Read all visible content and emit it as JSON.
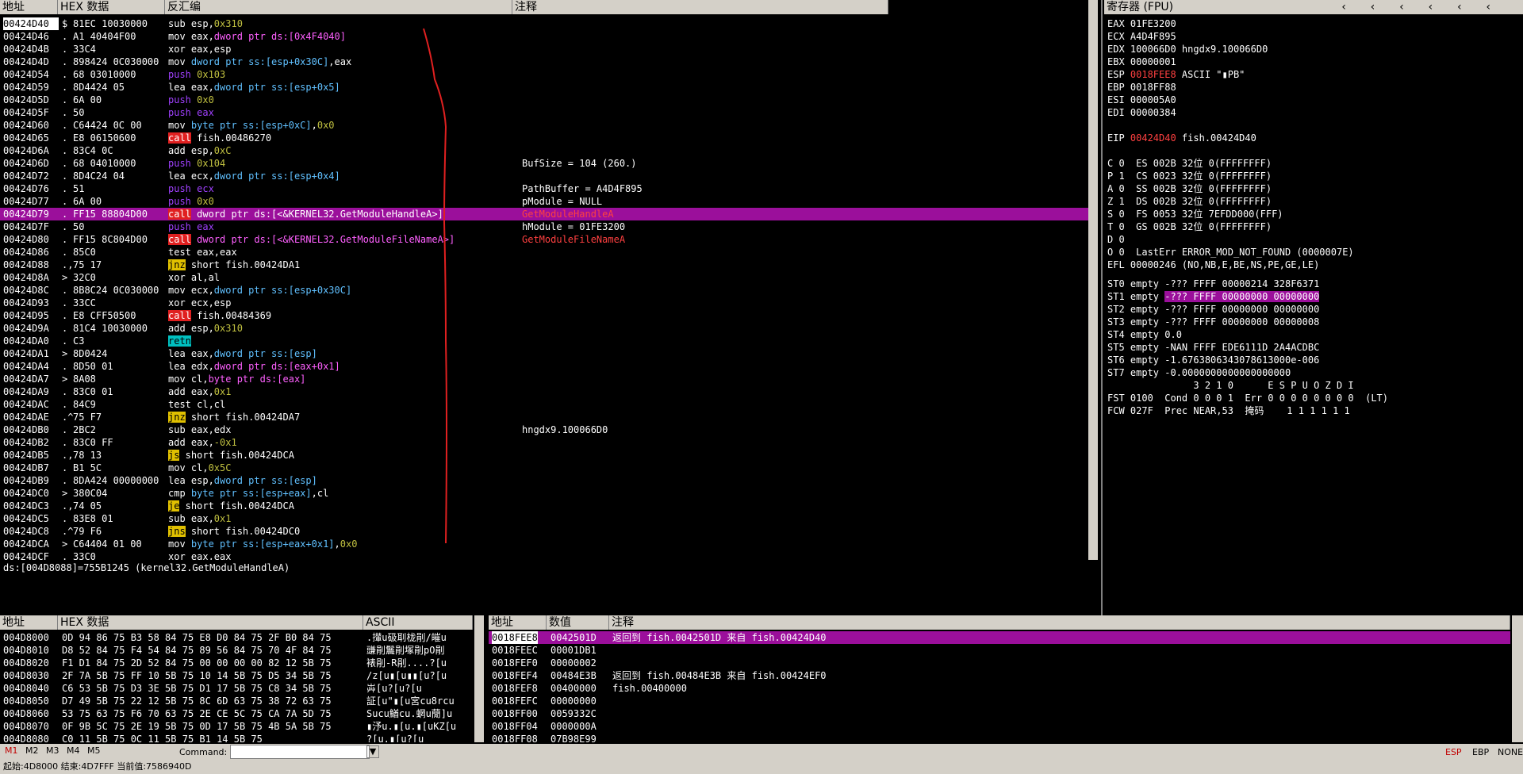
{
  "cpu": {
    "headers": {
      "addr": "地址",
      "hex": "HEX 数据",
      "disasm": "反汇编",
      "comment": "注释"
    },
    "rows": [
      {
        "addr": "00424D40",
        "m": "$",
        "hex": "81EC 10030000",
        "asm": [
          [
            "sub esp,",
            ""
          ],
          [
            "0x310",
            "imm"
          ]
        ],
        "cmt": ""
      },
      {
        "addr": "00424D46",
        "m": ".",
        "hex": "A1 40404F00",
        "asm": [
          [
            "mov eax,",
            ""
          ],
          [
            "dword ptr ds:[0x4F4040]",
            "mem"
          ]
        ],
        "cmt": ""
      },
      {
        "addr": "00424D4B",
        "m": ".",
        "hex": "33C4",
        "asm": [
          [
            "xor eax,esp",
            ""
          ]
        ],
        "cmt": ""
      },
      {
        "addr": "00424D4D",
        "m": ".",
        "hex": "898424 0C030000",
        "asm": [
          [
            "mov ",
            ""
          ],
          [
            "dword ptr ss:[esp+0x30C]",
            "blue"
          ],
          [
            ",eax",
            ""
          ]
        ],
        "cmt": ""
      },
      {
        "addr": "00424D54",
        "m": ".",
        "hex": "68 03010000",
        "asm": [
          [
            "push ",
            "push"
          ],
          [
            "0x103",
            "imm"
          ]
        ],
        "cmt": ""
      },
      {
        "addr": "00424D59",
        "m": ".",
        "hex": "8D4424 05",
        "asm": [
          [
            "lea eax,",
            ""
          ],
          [
            "dword ptr ss:[esp+0x5]",
            "blue"
          ]
        ],
        "cmt": ""
      },
      {
        "addr": "00424D5D",
        "m": ".",
        "hex": "6A 00",
        "asm": [
          [
            "push ",
            "push"
          ],
          [
            "0x0",
            "imm"
          ]
        ],
        "cmt": ""
      },
      {
        "addr": "00424D5F",
        "m": ".",
        "hex": "50",
        "asm": [
          [
            "push eax",
            "push"
          ]
        ],
        "cmt": ""
      },
      {
        "addr": "00424D60",
        "m": ".",
        "hex": "C64424 0C 00",
        "asm": [
          [
            "mov ",
            ""
          ],
          [
            "byte ptr ss:[esp+0xC]",
            "blue"
          ],
          [
            ",",
            ""
          ],
          [
            "0x0",
            "imm"
          ]
        ],
        "cmt": ""
      },
      {
        "addr": "00424D65",
        "m": ".",
        "hex": "E8 06150600",
        "asm": [
          [
            "call",
            "call"
          ],
          [
            " fish.00486270",
            ""
          ]
        ],
        "cmt": ""
      },
      {
        "addr": "00424D6A",
        "m": ".",
        "hex": "83C4 0C",
        "asm": [
          [
            "add esp,",
            ""
          ],
          [
            "0xC",
            "imm"
          ]
        ],
        "cmt": ""
      },
      {
        "addr": "00424D6D",
        "m": ".",
        "hex": "68 04010000",
        "asm": [
          [
            "push ",
            "push"
          ],
          [
            "0x104",
            "imm"
          ]
        ],
        "cmt": "BufSize = 104 (260.)"
      },
      {
        "addr": "00424D72",
        "m": ".",
        "hex": "8D4C24 04",
        "asm": [
          [
            "lea ecx,",
            ""
          ],
          [
            "dword ptr ss:[esp+0x4]",
            "blue"
          ]
        ],
        "cmt": ""
      },
      {
        "addr": "00424D76",
        "m": ".",
        "hex": "51",
        "asm": [
          [
            "push ecx",
            "push"
          ]
        ],
        "cmt": "PathBuffer = A4D4F895"
      },
      {
        "addr": "00424D77",
        "m": ".",
        "hex": "6A 00",
        "asm": [
          [
            "push ",
            "push"
          ],
          [
            "0x0",
            "imm"
          ]
        ],
        "cmt": "pModule = NULL"
      },
      {
        "addr": "00424D79",
        "m": ".",
        "hex": "FF15 88804D00",
        "asm": [
          [
            "call",
            "call"
          ],
          [
            " dword ptr ds:[<&KERNEL32.GetModuleHandleA>]",
            ""
          ]
        ],
        "cmt": "GetModuleHandleA",
        "sel": true
      },
      {
        "addr": "00424D7F",
        "m": ".",
        "hex": "50",
        "asm": [
          [
            "push eax",
            "push"
          ]
        ],
        "cmt": "hModule = 01FE3200"
      },
      {
        "addr": "00424D80",
        "m": ".",
        "hex": "FF15 8C804D00",
        "asm": [
          [
            "call",
            "call"
          ],
          [
            " dword ptr ds:[<&KERNEL32.GetModuleFileNameA>]",
            "mem"
          ]
        ],
        "cmt": "GetModuleFileNameA"
      },
      {
        "addr": "00424D86",
        "m": ".",
        "hex": "85C0",
        "asm": [
          [
            "test eax,eax",
            ""
          ]
        ],
        "cmt": ""
      },
      {
        "addr": "00424D88",
        "m": ".,",
        "hex": "75 17",
        "asm": [
          [
            "jnz",
            "jcc"
          ],
          [
            " short fish.00424DA1",
            ""
          ]
        ],
        "cmt": ""
      },
      {
        "addr": "00424D8A",
        "m": ">",
        "hex": "32C0",
        "asm": [
          [
            "xor al,al",
            ""
          ]
        ],
        "cmt": ""
      },
      {
        "addr": "00424D8C",
        "m": ".",
        "hex": "8B8C24 0C030000",
        "asm": [
          [
            "mov ecx,",
            ""
          ],
          [
            "dword ptr ss:[esp+0x30C]",
            "blue"
          ]
        ],
        "cmt": ""
      },
      {
        "addr": "00424D93",
        "m": ".",
        "hex": "33CC",
        "asm": [
          [
            "xor ecx,esp",
            ""
          ]
        ],
        "cmt": ""
      },
      {
        "addr": "00424D95",
        "m": ".",
        "hex": "E8 CFF50500",
        "asm": [
          [
            "call",
            "call"
          ],
          [
            " fish.00484369",
            ""
          ]
        ],
        "cmt": ""
      },
      {
        "addr": "00424D9A",
        "m": ".",
        "hex": "81C4 10030000",
        "asm": [
          [
            "add esp,",
            ""
          ],
          [
            "0x310",
            "imm"
          ]
        ],
        "cmt": ""
      },
      {
        "addr": "00424DA0",
        "m": ".",
        "hex": "C3",
        "asm": [
          [
            "retn",
            "retn"
          ]
        ],
        "cmt": ""
      },
      {
        "addr": "00424DA1",
        "m": ">",
        "hex": "8D0424",
        "asm": [
          [
            "lea eax,",
            ""
          ],
          [
            "dword ptr ss:[esp]",
            "blue"
          ]
        ],
        "cmt": ""
      },
      {
        "addr": "00424DA4",
        "m": ".",
        "hex": "8D50 01",
        "asm": [
          [
            "lea edx,",
            ""
          ],
          [
            "dword ptr ds:[eax+0x1]",
            "mem"
          ]
        ],
        "cmt": ""
      },
      {
        "addr": "00424DA7",
        "m": ">",
        "hex": "8A08",
        "asm": [
          [
            "mov cl,",
            ""
          ],
          [
            "byte ptr ds:[eax]",
            "mem"
          ]
        ],
        "cmt": ""
      },
      {
        "addr": "00424DA9",
        "m": ".",
        "hex": "83C0 01",
        "asm": [
          [
            "add eax,",
            ""
          ],
          [
            "0x1",
            "imm"
          ]
        ],
        "cmt": ""
      },
      {
        "addr": "00424DAC",
        "m": ".",
        "hex": "84C9",
        "asm": [
          [
            "test cl,cl",
            ""
          ]
        ],
        "cmt": ""
      },
      {
        "addr": "00424DAE",
        "m": ".^",
        "hex": "75 F7",
        "asm": [
          [
            "jnz",
            "jcc"
          ],
          [
            " short fish.00424DA7",
            ""
          ]
        ],
        "cmt": ""
      },
      {
        "addr": "00424DB0",
        "m": ".",
        "hex": "2BC2",
        "asm": [
          [
            "sub eax,edx",
            ""
          ]
        ],
        "cmt": "hngdx9.100066D0"
      },
      {
        "addr": "00424DB2",
        "m": ".",
        "hex": "83C0 FF",
        "asm": [
          [
            "add eax,",
            ""
          ],
          [
            "-0x1",
            "imm"
          ]
        ],
        "cmt": ""
      },
      {
        "addr": "00424DB5",
        "m": ".,",
        "hex": "78 13",
        "asm": [
          [
            "js",
            "jcc"
          ],
          [
            " short fish.00424DCA",
            ""
          ]
        ],
        "cmt": ""
      },
      {
        "addr": "00424DB7",
        "m": ".",
        "hex": "B1 5C",
        "asm": [
          [
            "mov cl,",
            ""
          ],
          [
            "0x5C",
            "imm"
          ]
        ],
        "cmt": ""
      },
      {
        "addr": "00424DB9",
        "m": ".",
        "hex": "8DA424 00000000",
        "asm": [
          [
            "lea esp,",
            ""
          ],
          [
            "dword ptr ss:[esp]",
            "blue"
          ]
        ],
        "cmt": ""
      },
      {
        "addr": "00424DC0",
        "m": ">",
        "hex": "380C04",
        "asm": [
          [
            "cmp ",
            ""
          ],
          [
            "byte ptr ss:[esp+eax]",
            "blue"
          ],
          [
            ",cl",
            ""
          ]
        ],
        "cmt": ""
      },
      {
        "addr": "00424DC3",
        "m": ".,",
        "hex": "74 05",
        "asm": [
          [
            "je",
            "jcc"
          ],
          [
            " short fish.00424DCA",
            ""
          ]
        ],
        "cmt": ""
      },
      {
        "addr": "00424DC5",
        "m": ".",
        "hex": "83E8 01",
        "asm": [
          [
            "sub eax,",
            ""
          ],
          [
            "0x1",
            "imm"
          ]
        ],
        "cmt": ""
      },
      {
        "addr": "00424DC8",
        "m": ".^",
        "hex": "79 F6",
        "asm": [
          [
            "jns",
            "jcc"
          ],
          [
            " short fish.00424DC0",
            ""
          ]
        ],
        "cmt": ""
      },
      {
        "addr": "00424DCA",
        "m": ">",
        "hex": "C64404 01 00",
        "asm": [
          [
            "mov ",
            ""
          ],
          [
            "byte ptr ss:[esp+eax+0x1]",
            "blue"
          ],
          [
            ",",
            ""
          ],
          [
            "0x0",
            "imm"
          ]
        ],
        "cmt": ""
      },
      {
        "addr": "00424DCF",
        "m": ".",
        "hex": "33C0",
        "asm": [
          [
            "xor eax,eax",
            ""
          ]
        ],
        "cmt": ""
      }
    ],
    "info_line": "ds:[004D8088]=755B1245 (kernel32.GetModuleHandleA)"
  },
  "registers": {
    "title": "寄存器 (FPU)",
    "general": [
      {
        "name": "EAX",
        "value": "01FE3200",
        "desc": ""
      },
      {
        "name": "ECX",
        "value": "A4D4F895",
        "desc": ""
      },
      {
        "name": "EDX",
        "value": "100066D0",
        "desc": "hngdx9.100066D0"
      },
      {
        "name": "EBX",
        "value": "00000001",
        "desc": ""
      },
      {
        "name": "ESP",
        "value": "0018FEE8",
        "desc": "ASCII \"▮PB\"",
        "red": true
      },
      {
        "name": "EBP",
        "value": "0018FF88",
        "desc": ""
      },
      {
        "name": "ESI",
        "value": "000005A0",
        "desc": ""
      },
      {
        "name": "EDI",
        "value": "00000384",
        "desc": ""
      }
    ],
    "eip": {
      "name": "EIP",
      "value": "00424D40",
      "desc": "fish.00424D40"
    },
    "flags": [
      "C 0  ES 002B 32位 0(FFFFFFFF)",
      "P 1  CS 0023 32位 0(FFFFFFFF)",
      "A 0  SS 002B 32位 0(FFFFFFFF)",
      "Z 1  DS 002B 32位 0(FFFFFFFF)",
      "S 0  FS 0053 32位 7EFDD000(FFF)",
      "T 0  GS 002B 32位 0(FFFFFFFF)",
      "D 0",
      "O 0  LastErr ERROR_MOD_NOT_FOUND (0000007E)"
    ],
    "efl": "EFL 00000246 (NO,NB,E,BE,NS,PE,GE,LE)",
    "fpu": [
      {
        "text": "ST0 empty -??? FFFF 00000214 328F6371",
        "hl": ""
      },
      {
        "text": "ST1 empty ",
        "hl": "-??? FFFF 00000000 00000000"
      },
      {
        "text": "ST2 empty -??? FFFF 00000000 00000000",
        "hl": ""
      },
      {
        "text": "ST3 empty -??? FFFF 00000000 00000008",
        "hl": ""
      },
      {
        "text": "ST4 empty 0.0",
        "hl": ""
      },
      {
        "text": "ST5 empty -NAN FFFF EDE6111D 2A4ACDBC",
        "hl": ""
      },
      {
        "text": "ST6 empty -1.6763806343078613000e-006",
        "hl": ""
      },
      {
        "text": "ST7 empty -0.0000000000000000000",
        "hl": ""
      }
    ],
    "fpu_tail": [
      "               3 2 1 0      E S P U O Z D I",
      "FST 0100  Cond 0 0 0 1  Err 0 0 0 0 0 0 0 0  (LT)",
      "FCW 027F  Prec NEAR,53  掩码    1 1 1 1 1 1"
    ]
  },
  "dump": {
    "headers": {
      "addr": "地址",
      "hex": "HEX 数据",
      "ascii": "ASCII"
    },
    "rows": [
      {
        "addr": "004D8000",
        "hex": "0D 94 86 75 B3 58 84 75 E8 D0 84 75 2F B0 84 75",
        "ascii": ".攆u砐刵栊剈/皠u"
      },
      {
        "addr": "004D8010",
        "hex": "D8 52 84 75 F4 54 84 75 89 56 84 75 70 4F 84 75",
        "ascii": "豏剈鬞剈塚剈pO剈"
      },
      {
        "addr": "004D8020",
        "hex": "F1 D1 84 75 2D 52 84 75 00 00 00 00 82 12 5B 75",
        "ascii": "裱剈-R剈....?[u"
      },
      {
        "addr": "004D8030",
        "hex": "2F 7A 5B 75 FF 10 5B 75 10 14 5B 75 D5 34 5B 75",
        "ascii": "/z[u▮[u▮▮[u?[u"
      },
      {
        "addr": "004D8040",
        "hex": "C6 53 5B 75 D3 3E 5B 75 D1 17 5B 75 C8 34 5B 75",
        "ascii": "芔[u?[u?[u"
      },
      {
        "addr": "004D8050",
        "hex": "D7 49 5B 75 22 12 5B 75 8C 6D 63 75 38 72 63 75",
        "ascii": "証[u\"▮[u宮cu8rcu"
      },
      {
        "addr": "004D8060",
        "hex": "53 75 63 75 F6 70 63 75 2E CE 5C 75 CA 7A 5D 75",
        "ascii": "Sucu鰌cu.蝄u蕑]u"
      },
      {
        "addr": "004D8070",
        "hex": "0F 9B 5C 75 2E 19 5B 75 0D 17 5B 75 4B 5A 5B 75",
        "ascii": "▮汿u.▮[u.▮[uKZ[u"
      },
      {
        "addr": "004D8080",
        "hex": "C0 11 5B 75 0C 11 5B 75 B1 14 5B 75",
        "ascii": "?[u.▮[u?[u"
      }
    ]
  },
  "stack": {
    "headers": {
      "addr": "地址",
      "val": "数值",
      "cmt": "注释"
    },
    "rows": [
      {
        "addr": "0018FEE8",
        "val": "0042501D",
        "cmt": "返回到 fish.0042501D 来自 fish.00424D40",
        "sel": true
      },
      {
        "addr": "0018FEEC",
        "val": "00001DB1",
        "cmt": ""
      },
      {
        "addr": "0018FEF0",
        "val": "00000002",
        "cmt": ""
      },
      {
        "addr": "0018FEF4",
        "val": "00484E3B",
        "cmt": "返回到 fish.00484E3B 来自 fish.00424EF0"
      },
      {
        "addr": "0018FEF8",
        "val": "00400000",
        "cmt": "fish.00400000"
      },
      {
        "addr": "0018FEFC",
        "val": "00000000",
        "cmt": ""
      },
      {
        "addr": "0018FF00",
        "val": "0059332C",
        "cmt": ""
      },
      {
        "addr": "0018FF04",
        "val": "0000000A",
        "cmt": ""
      },
      {
        "addr": "0018FF08",
        "val": "07B98E99",
        "cmt": ""
      }
    ]
  },
  "cmdbar": {
    "tabs": [
      "M1",
      "M2",
      "M3",
      "M4",
      "M5"
    ],
    "command_label": "Command:",
    "command_value": "",
    "right": [
      "ESP",
      "EBP",
      "NONE"
    ]
  },
  "status": "起始:4D8000 结束:4D7FFF 当前值:7586940D",
  "colors": {
    "selection": "#9b0f9b",
    "call": "#e02020",
    "jump": "#e0c000",
    "annotation": "#e02020"
  }
}
